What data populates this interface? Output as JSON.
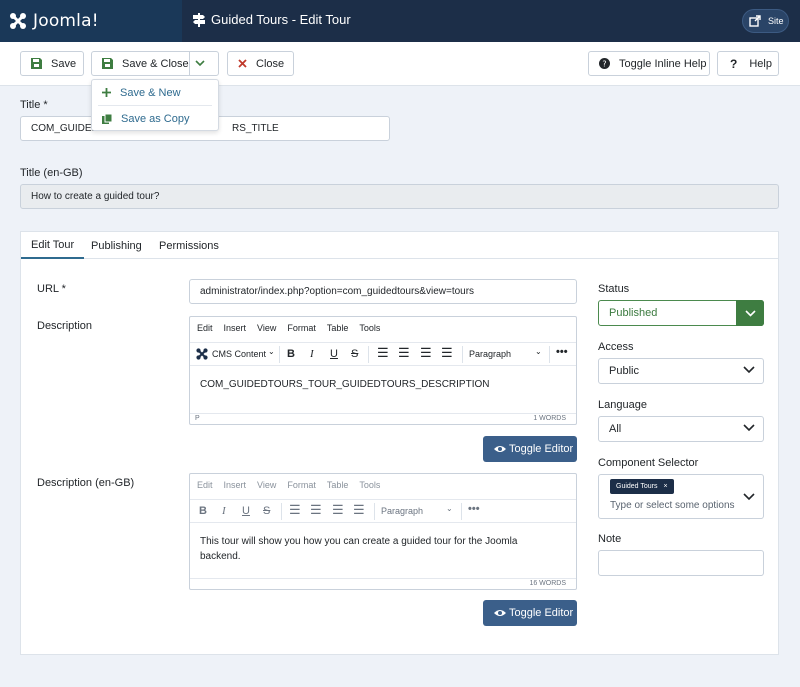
{
  "header": {
    "logo_text": "Joomla!",
    "page_title": "Guided Tours - Edit Tour",
    "site_label": "Site"
  },
  "toolbar": {
    "save": "Save",
    "save_close": "Save & Close",
    "close": "Close",
    "toggle_inline_help": "Toggle Inline Help",
    "help": "Help"
  },
  "dropdown": {
    "save_new": "Save & New",
    "save_copy": "Save as Copy"
  },
  "form": {
    "title_label": "Title *",
    "title_value": "COM_GUIDED",
    "title_value_tail": "RS_TITLE",
    "title_engb_label": "Title (en-GB)",
    "title_engb_value": "How to create a guided tour?"
  },
  "tabs": [
    {
      "label": "Edit Tour"
    },
    {
      "label": "Publishing"
    },
    {
      "label": "Permissions"
    }
  ],
  "fields": {
    "url_label": "URL *",
    "url_value": "administrator/index.php?option=com_guidedtours&view=tours",
    "description_label": "Description",
    "description_engb_label": "Description (en-GB)"
  },
  "editor1": {
    "menu": [
      "Edit",
      "Insert",
      "View",
      "Format",
      "Table",
      "Tools"
    ],
    "cms_content": "CMS Content",
    "block_format": "Paragraph",
    "content": "COM_GUIDEDTOURS_TOUR_GUIDEDTOURS_DESCRIPTION",
    "path": "P",
    "words": "1 WORDS",
    "toggle": "Toggle Editor"
  },
  "editor2": {
    "menu": [
      "Edit",
      "Insert",
      "View",
      "Format",
      "Table",
      "Tools"
    ],
    "block_format": "Paragraph",
    "content": "This tour will show you how you can create a guided tour for the Joomla backend.",
    "words": "16 WORDS",
    "toggle": "Toggle Editor"
  },
  "sidebar": {
    "status_label": "Status",
    "status_value": "Published",
    "access_label": "Access",
    "access_value": "Public",
    "language_label": "Language",
    "language_value": "All",
    "component_label": "Component Selector",
    "component_chip": "Guided Tours",
    "component_placeholder": "Type or select some options",
    "note_label": "Note"
  },
  "colors": {
    "header_bg": "#1c2e48",
    "accent": "#3b5f8a",
    "status_green": "#3e7d41"
  }
}
